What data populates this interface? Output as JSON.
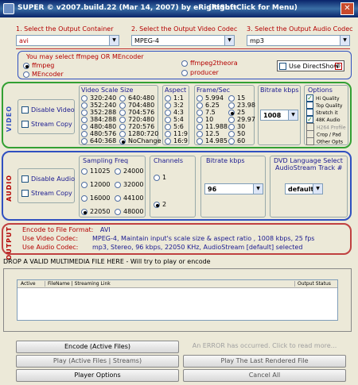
{
  "title": {
    "app": "SUPER © v2007.build.22 (Mar 14, 2007) by eRightSoft",
    "menu_hint": "(Right-Click for Menu)"
  },
  "selectors": {
    "container": {
      "label": "1.     Select the Output Container",
      "value": "avi"
    },
    "video_codec": {
      "label": "2.     Select the Output Video Codec",
      "value": "MPEG-4"
    },
    "audio_codec": {
      "label": "3.     Select the Output Audio Codec",
      "value": "mp3"
    }
  },
  "encoder": {
    "prompt": "You may select ffmpeg OR MEncoder",
    "options": [
      "ffmpeg",
      "MEncoder",
      "ffmpeg2theora",
      "producer"
    ],
    "selected": "ffmpeg",
    "directshow": "Use DirectShow"
  },
  "video": {
    "side_label": "VIDEO",
    "disable": "Disable Video",
    "stream_copy": "Stream Copy",
    "scale_title": "Video Scale Size",
    "scale_col1": [
      "320:240",
      "352:240",
      "352:288",
      "384:288",
      "480:480",
      "480:576",
      "640:368"
    ],
    "scale_col2": [
      "640:480",
      "704:480",
      "704:576",
      "720:480",
      "720:576",
      "1280:720",
      "NoChange"
    ],
    "scale_selected": "NoChange",
    "aspect_title": "Aspect",
    "aspect": [
      "1:1",
      "3:2",
      "4:3",
      "5:4",
      "5:6",
      "11:9",
      "16:9"
    ],
    "fps_title": "Frame/Sec",
    "fps_col1": [
      "5.994",
      "6.25",
      "7.5",
      "10",
      "11.988",
      "12.5",
      "14.985"
    ],
    "fps_col2": [
      "15",
      "23.98",
      "25",
      "29.97",
      "30",
      "50",
      "60"
    ],
    "fps_selected": "25",
    "bitrate_title": "Bitrate  kbps",
    "bitrate": "1008",
    "options_title": "Options",
    "options": [
      "Hi Quality",
      "Top Quality",
      "Stretch it",
      "48K Audio",
      "H264 Profile",
      "Crop / Pad",
      "Other Opts"
    ],
    "options_checked": [
      "Hi Quality",
      "48K Audio"
    ]
  },
  "audio": {
    "side_label": "AUDIO",
    "disable": "Disable Audio",
    "stream_copy": "Stream Copy",
    "freq_title": "Sampling Freq",
    "freq_col1": [
      "11025",
      "12000",
      "16000",
      "22050"
    ],
    "freq_col2": [
      "24000",
      "32000",
      "44100",
      "48000"
    ],
    "freq_selected": "22050",
    "channels_title": "Channels",
    "channels": [
      "1",
      "2"
    ],
    "channels_selected": "2",
    "bitrate_title": "Bitrate  kbps",
    "bitrate": "96",
    "dvd_title": "DVD Language Select",
    "dvd_sub": "AudioStream  Track #",
    "dvd_value": "default"
  },
  "output": {
    "side_label": "OUTPUT",
    "format_label": "Encode to File Format:",
    "format_value": "AVI",
    "video_label": "Use Video Codec:",
    "video_value": "MPEG-4,  Maintain input's scale size & aspect ratio ,  1008 kbps,  25 fps",
    "audio_label": "Use Audio Codec:",
    "audio_value": "mp3,  Stereo,  96 kbps,  22050 KHz,  AudioStream [default] selected"
  },
  "drop_hint": "DROP A VALID MULTIMEDIA FILE HERE - Will try to play or encode",
  "file_table": {
    "columns": [
      "Active",
      "FileName  |  Streaming Link",
      "Output Status"
    ]
  },
  "buttons": {
    "encode": "Encode (Active Files)",
    "error": "An ERROR has occurred. Click to read more...",
    "play_active": "Play (Active Files | Streams)",
    "play_last": "Play The Last Rendered File",
    "player_options": "Player Options",
    "cancel_all": "Cancel All"
  },
  "colors": {
    "video_border": "#33a033",
    "audio_border": "#3050c0",
    "output_border": "#c04040"
  }
}
